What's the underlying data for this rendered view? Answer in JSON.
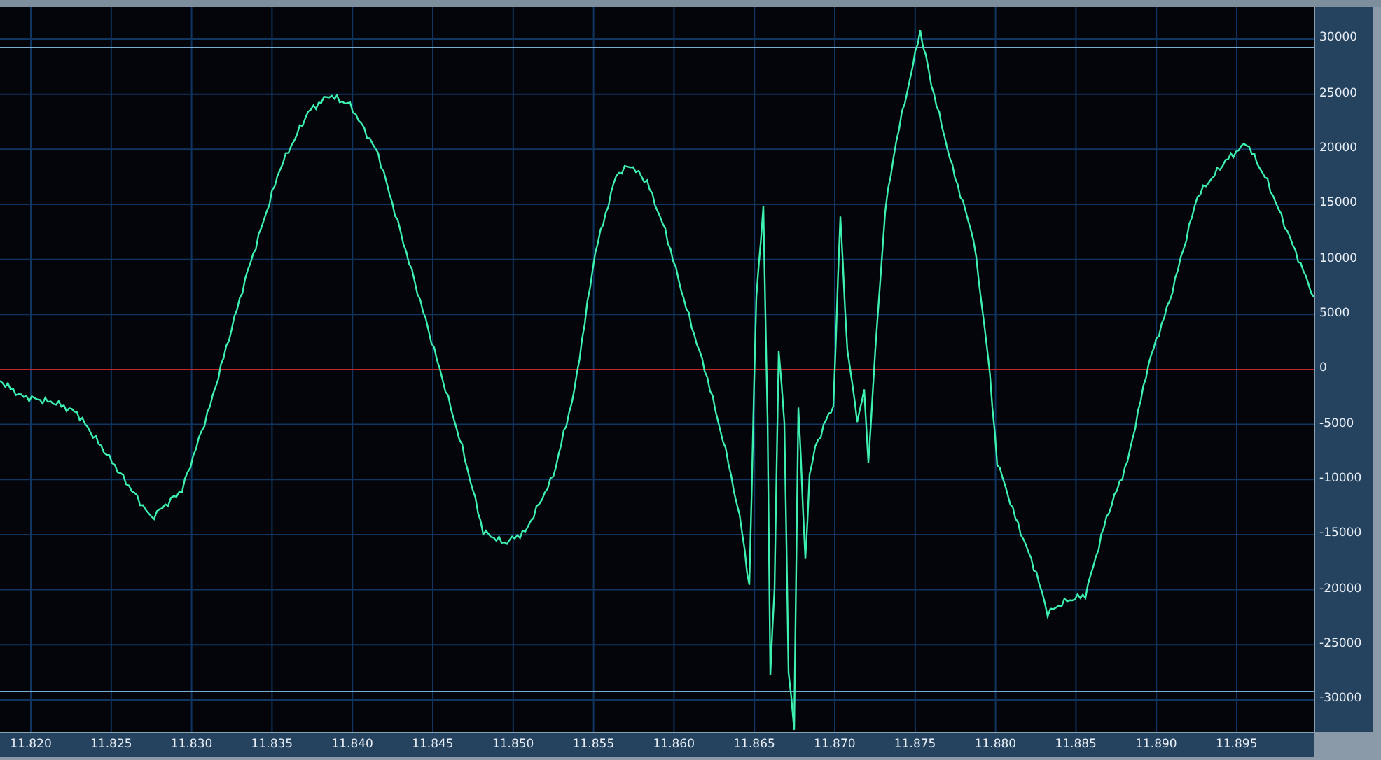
{
  "y_axis": {
    "labels": [
      "30000",
      "25000",
      "20000",
      "15000",
      "10000",
      "5000",
      "0",
      "-5000",
      "-10000",
      "-15000",
      "-20000",
      "-25000",
      "-30000"
    ]
  },
  "x_axis": {
    "labels": [
      "11.820",
      "11.825",
      "11.830",
      "11.835",
      "11.840",
      "11.845",
      "11.850",
      "11.855",
      "11.860",
      "11.865",
      "11.870",
      "11.875",
      "11.880",
      "11.885",
      "11.890",
      "11.895"
    ]
  }
}
